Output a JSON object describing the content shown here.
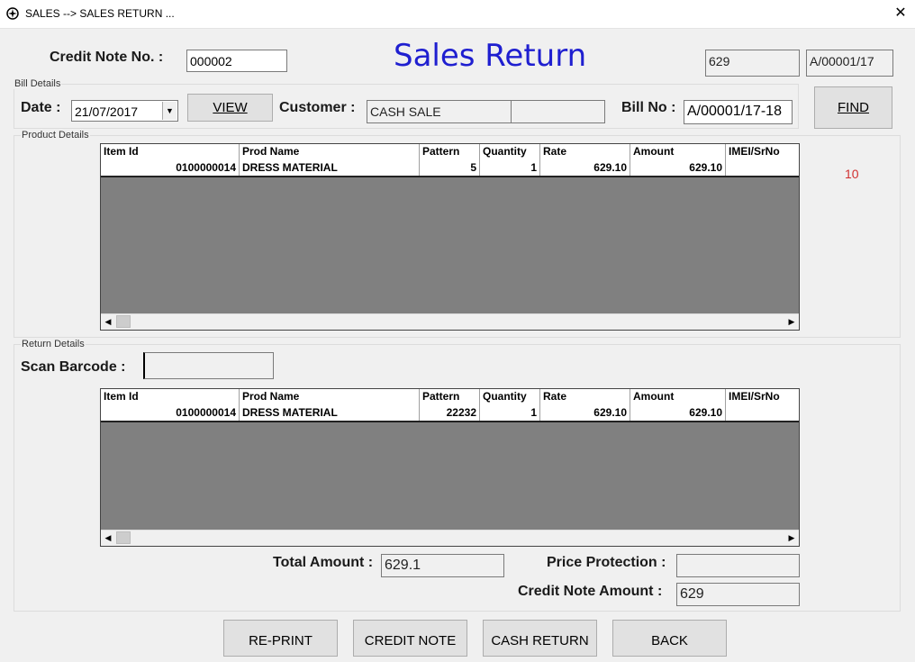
{
  "window": {
    "title": "SALES --> SALES RETURN ..."
  },
  "header": {
    "credit_note_label": "Credit Note No. :",
    "credit_note_value": "000002",
    "title": "Sales Return",
    "box1": "629",
    "box2": "A/00001/17"
  },
  "bill": {
    "group_caption": "Bill Details",
    "date_label": "Date :",
    "date_value": "21/07/2017",
    "view_button": "VIEW",
    "customer_label": "Customer :",
    "customer_value": "CASH SALE",
    "customer_extra": "",
    "bill_no_label": "Bill No :",
    "bill_no_value": "A/00001/17-18",
    "find_button": "FIND",
    "count": "10"
  },
  "product": {
    "group_caption": "Product Details",
    "columns": [
      "Item Id",
      "Prod Name",
      "Pattern",
      "Quantity",
      "Rate",
      "Amount",
      "IMEI/SrNo"
    ],
    "rows": [
      [
        "0100000014",
        "DRESS MATERIAL",
        "5",
        "1",
        "629.10",
        "629.10",
        ""
      ]
    ]
  },
  "return": {
    "group_caption": "Return Details",
    "scan_label": "Scan Barcode :",
    "scan_value": "",
    "columns": [
      "Item Id",
      "Prod Name",
      "Pattern",
      "Quantity",
      "Rate",
      "Amount",
      "IMEI/SrNo"
    ],
    "rows": [
      [
        "0100000014",
        "DRESS MATERIAL",
        "22232",
        "1",
        "629.10",
        "629.10",
        ""
      ]
    ]
  },
  "totals": {
    "total_label": "Total Amount :",
    "total_value": "629.1",
    "price_protection_label": "Price Protection :",
    "price_protection_value": "",
    "credit_note_amount_label": "Credit Note Amount :",
    "credit_note_amount_value": "629"
  },
  "buttons": {
    "reprint": "RE-PRINT",
    "credit_note": "CREDIT NOTE",
    "cash_return": "CASH RETURN",
    "back": "BACK"
  },
  "colors": {
    "title": "#1f1fd0",
    "count": "#d03030"
  }
}
